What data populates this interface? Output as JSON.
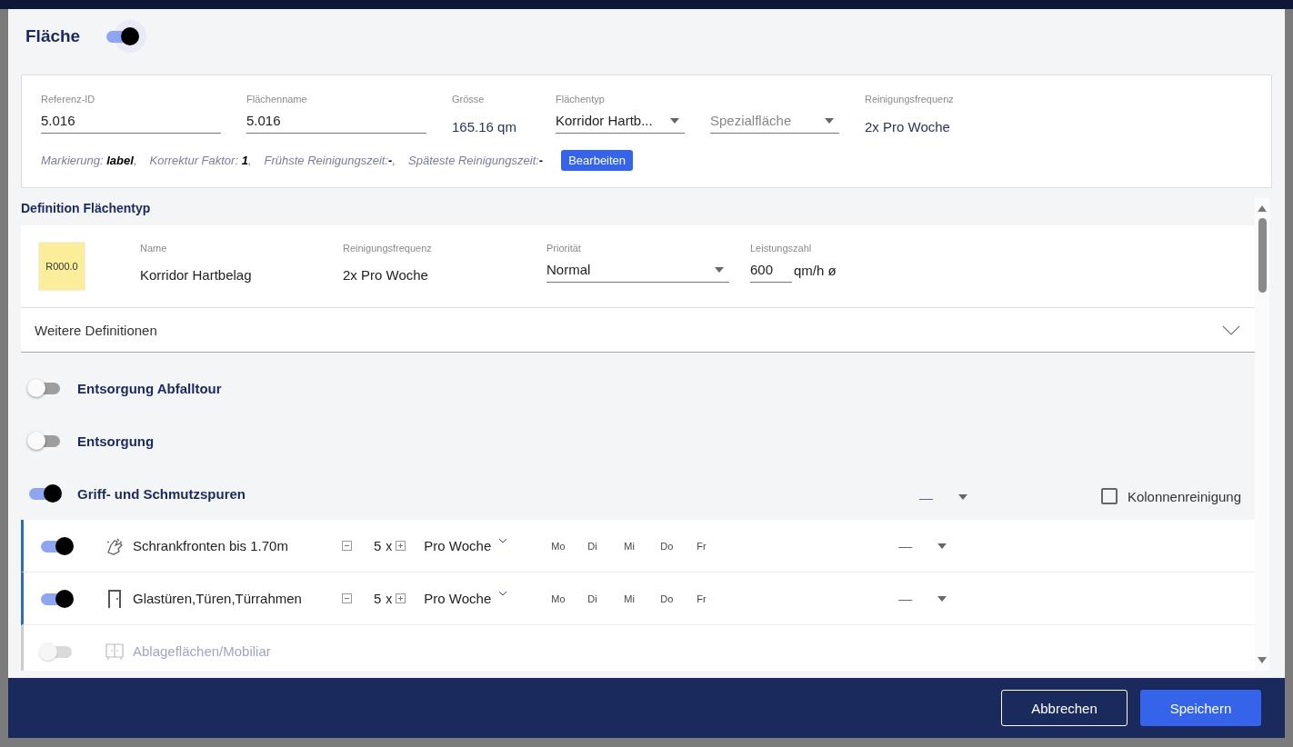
{
  "dialog": {
    "title": "Fläche",
    "on": true
  },
  "area": {
    "fields": [
      {
        "kind": "input",
        "label": "Referenz-ID",
        "value": "5.016"
      },
      {
        "kind": "input",
        "label": "Flächenname",
        "value": "5.016"
      },
      {
        "kind": "text",
        "label": "Grösse",
        "value": "165.16 qm"
      },
      {
        "kind": "select",
        "label": "Flächentyp",
        "value": "Korridor Hartb..."
      },
      {
        "kind": "select",
        "placeholder": "Spezialfläche"
      },
      {
        "kind": "text",
        "label": "Reinigungsfrequenz",
        "value": "2x Pro Woche"
      }
    ],
    "meta": [
      "Markierung: **label**,",
      "Korrektur Faktor: **1**,",
      "Frühste Reinigungszeit:**-**,",
      "Späteste Reinigungszeit:**-**"
    ],
    "edit_button": "Bearbeiten"
  },
  "definition": {
    "title": "Definition Flächentyp",
    "code": "R000.0",
    "fields": [
      {
        "kind": "text",
        "label": "Name",
        "value": "Korridor Hartbelag"
      },
      {
        "kind": "text",
        "label": "Reinigungsfrequenz",
        "value": "2x Pro Woche"
      },
      {
        "kind": "select",
        "label": "Priorität",
        "value": "Normal"
      },
      {
        "kind": "number",
        "label": "Leistungszahl",
        "value": "600",
        "unit": "qm/h ø"
      }
    ],
    "more": {
      "label": "Weitere Definitionen",
      "expanded": false
    }
  },
  "groups": [
    {
      "title": "Entsorgung Abfalltour",
      "on": false
    },
    {
      "title": "Entsorgung",
      "on": false
    },
    {
      "title": "Griff- und Schmutzspuren",
      "on": true,
      "rating": "—",
      "column_cleaning": {
        "label": "Kolonnenreinigung",
        "checked": false
      },
      "items": [
        {
          "label": "Schrankfronten bis 1.70m",
          "on": true,
          "disabled": false,
          "count": "5",
          "unit": "x",
          "period": "Pro Woche",
          "days": [
            "Mo",
            "Di",
            "Mi",
            "Do",
            "Fr"
          ],
          "rating": "—"
        },
        {
          "label": "Glastüren,Türen,Türrahmen",
          "on": true,
          "disabled": false,
          "count": "5",
          "unit": "x",
          "period": "Pro Woche",
          "days": [
            "Mo",
            "Di",
            "Mi",
            "Do",
            "Fr"
          ],
          "rating": "—"
        },
        {
          "label": "Ablageflächen/Mobiliar",
          "on": false,
          "disabled": true
        }
      ]
    }
  ],
  "footer": {
    "buttons": [
      {
        "kind": "secondary",
        "label": "Abbrechen"
      },
      {
        "kind": "primary",
        "label": "Speichern"
      }
    ]
  }
}
